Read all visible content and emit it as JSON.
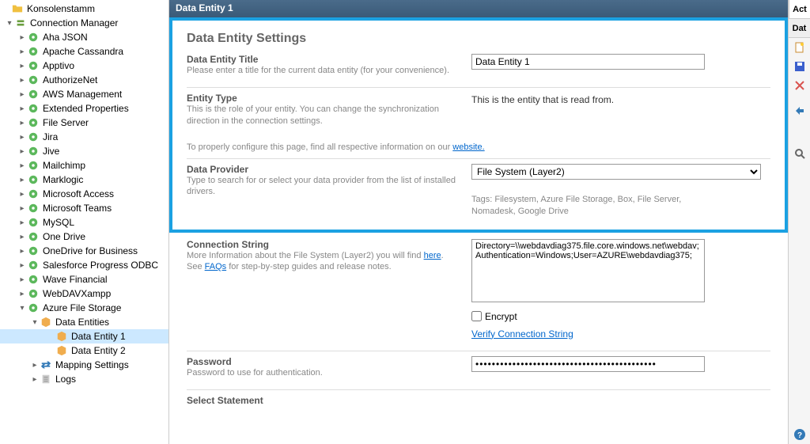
{
  "tree": {
    "root": "Konsolenstamm",
    "conn_manager": "Connection Manager",
    "items": [
      "Aha JSON",
      "Apache Cassandra",
      "Apptivo",
      "AuthorizeNet",
      "AWS Management",
      "Extended Properties",
      "File Server",
      "Jira",
      "Jive",
      "Mailchimp",
      "Marklogic",
      "Microsoft Access",
      "Microsoft Teams",
      "MySQL",
      "One Drive",
      "OneDrive for Business",
      "Salesforce Progress ODBC",
      "Wave Financial",
      "WebDAVXampp"
    ],
    "azure": "Azure File Storage",
    "data_entities": "Data Entities",
    "entity1": "Data Entity 1",
    "entity2": "Data Entity 2",
    "mapping": "Mapping Settings",
    "logs": "Logs"
  },
  "main": {
    "title": "Data Entity 1",
    "section_title": "Data Entity Settings",
    "det": {
      "label": "Data Entity Title",
      "desc": "Please enter a title for the current data entity (for your convenience).",
      "value": "Data Entity 1"
    },
    "etype": {
      "label": "Entity Type",
      "desc": "This is the role of your entity. You can change the synchronization direction in the connection settings.",
      "value": "This is the entity that is read from."
    },
    "info_prefix": "To properly configure this page, find all respective information on our ",
    "info_link": "website.",
    "provider": {
      "label": "Data Provider",
      "desc": "Type to search for or select your data provider from the list of installed drivers.",
      "value": "File System (Layer2)",
      "tags": "Tags: Filesystem, Azure File Storage, Box, File Server, Nomadesk, Google Drive"
    },
    "conn": {
      "label": "Connection String",
      "desc_pre": "More Information about the File System (Layer2) you will find ",
      "here": "here",
      "desc_mid": ". See ",
      "faqs": "FAQs",
      "desc_post": " for step-by-step guides and release notes.",
      "value": "Directory=\\\\webdavdiag375.file.core.windows.net\\webdav;Authentication=Windows;User=AZURE\\webdavdiag375;",
      "encrypt": "Encrypt",
      "verify": "Verify Connection String"
    },
    "password": {
      "label": "Password",
      "desc": "Password to use for authentication.",
      "value": "••••••••••••••••••••••••••••••••••••••••••••"
    },
    "select_stmt": {
      "label": "Select Statement"
    }
  },
  "rpane": {
    "act": "Act",
    "dat": "Dat"
  }
}
